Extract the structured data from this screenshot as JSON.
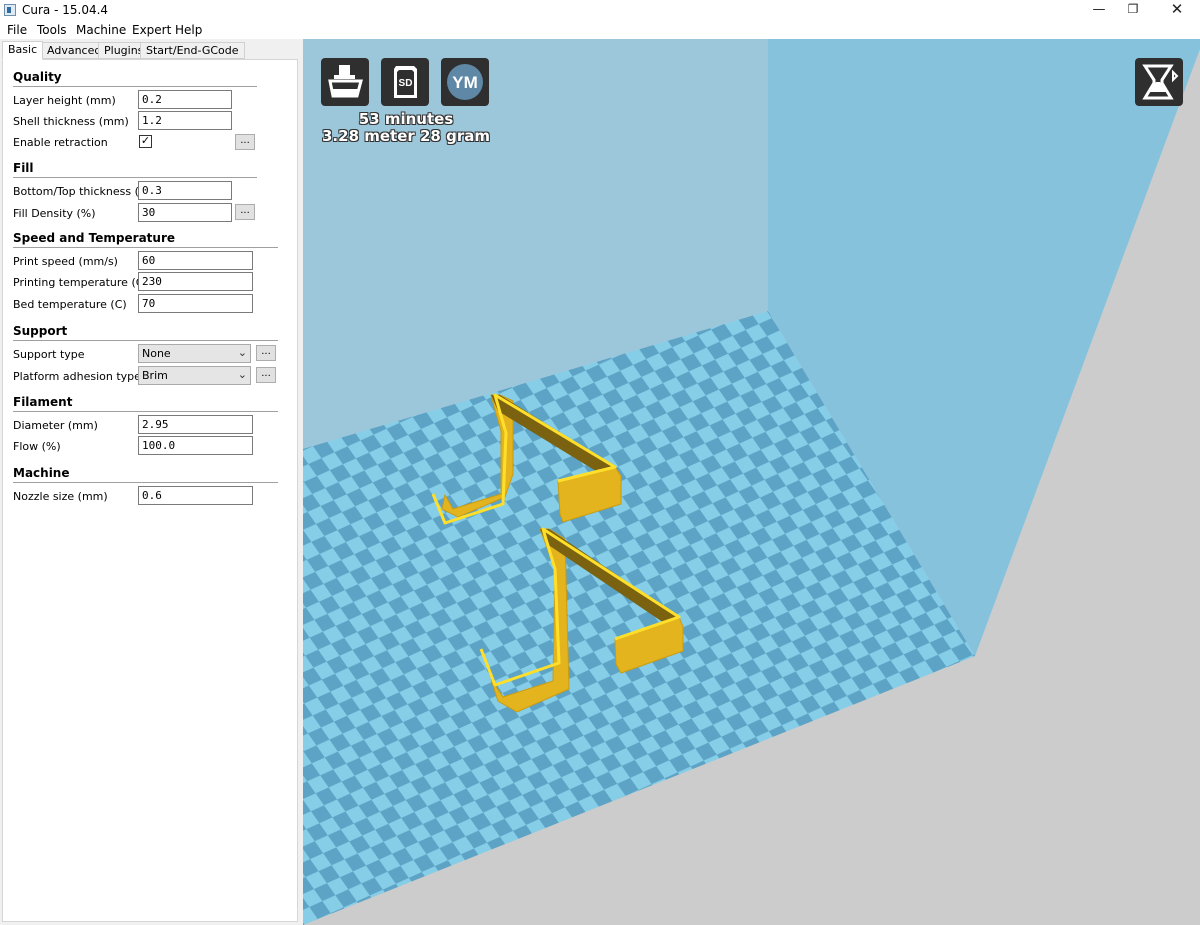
{
  "window": {
    "title": "Cura - 15.04.4",
    "minimize": "—",
    "restore": "❐",
    "close": "✕"
  },
  "menu": [
    "File",
    "Tools",
    "Machine",
    "Expert",
    "Help"
  ],
  "tabs": [
    "Basic",
    "Advanced",
    "Plugins",
    "Start/End-GCode"
  ],
  "sections": {
    "quality": {
      "title": "Quality",
      "layer_height_label": "Layer height (mm)",
      "layer_height": "0.2",
      "shell_thickness_label": "Shell thickness (mm)",
      "shell_thickness": "1.2",
      "retraction_label": "Enable retraction",
      "retraction_checked": true
    },
    "fill": {
      "title": "Fill",
      "bottom_top_label": "Bottom/Top thickness (mm)",
      "bottom_top": "0.3",
      "density_label": "Fill Density (%)",
      "density": "30"
    },
    "speed": {
      "title": "Speed and Temperature",
      "print_speed_label": "Print speed (mm/s)",
      "print_speed": "60",
      "print_temp_label": "Printing temperature (C)",
      "print_temp": "230",
      "bed_temp_label": "Bed temperature (C)",
      "bed_temp": "70"
    },
    "support": {
      "title": "Support",
      "type_label": "Support type",
      "type": "None",
      "adhesion_label": "Platform adhesion type",
      "adhesion": "Brim"
    },
    "filament": {
      "title": "Filament",
      "diameter_label": "Diameter (mm)",
      "diameter": "2.95",
      "flow_label": "Flow (%)",
      "flow": "100.0"
    },
    "machine": {
      "title": "Machine",
      "nozzle_label": "Nozzle size (mm)",
      "nozzle": "0.6"
    }
  },
  "more_button": "...",
  "viewport": {
    "sd_label": "SD",
    "ym_label": "YM",
    "print_time": "53 minutes",
    "print_material": "3.28 meter 28 gram"
  },
  "colors": {
    "wall_back": "#9cc6d9",
    "wall_right": "#86c2dc",
    "floor_light": "#86cde7",
    "floor_dark": "#5ca3c6",
    "outside": "#cccccc",
    "model": "#e8b921",
    "model_top": "#ffdf2a"
  }
}
